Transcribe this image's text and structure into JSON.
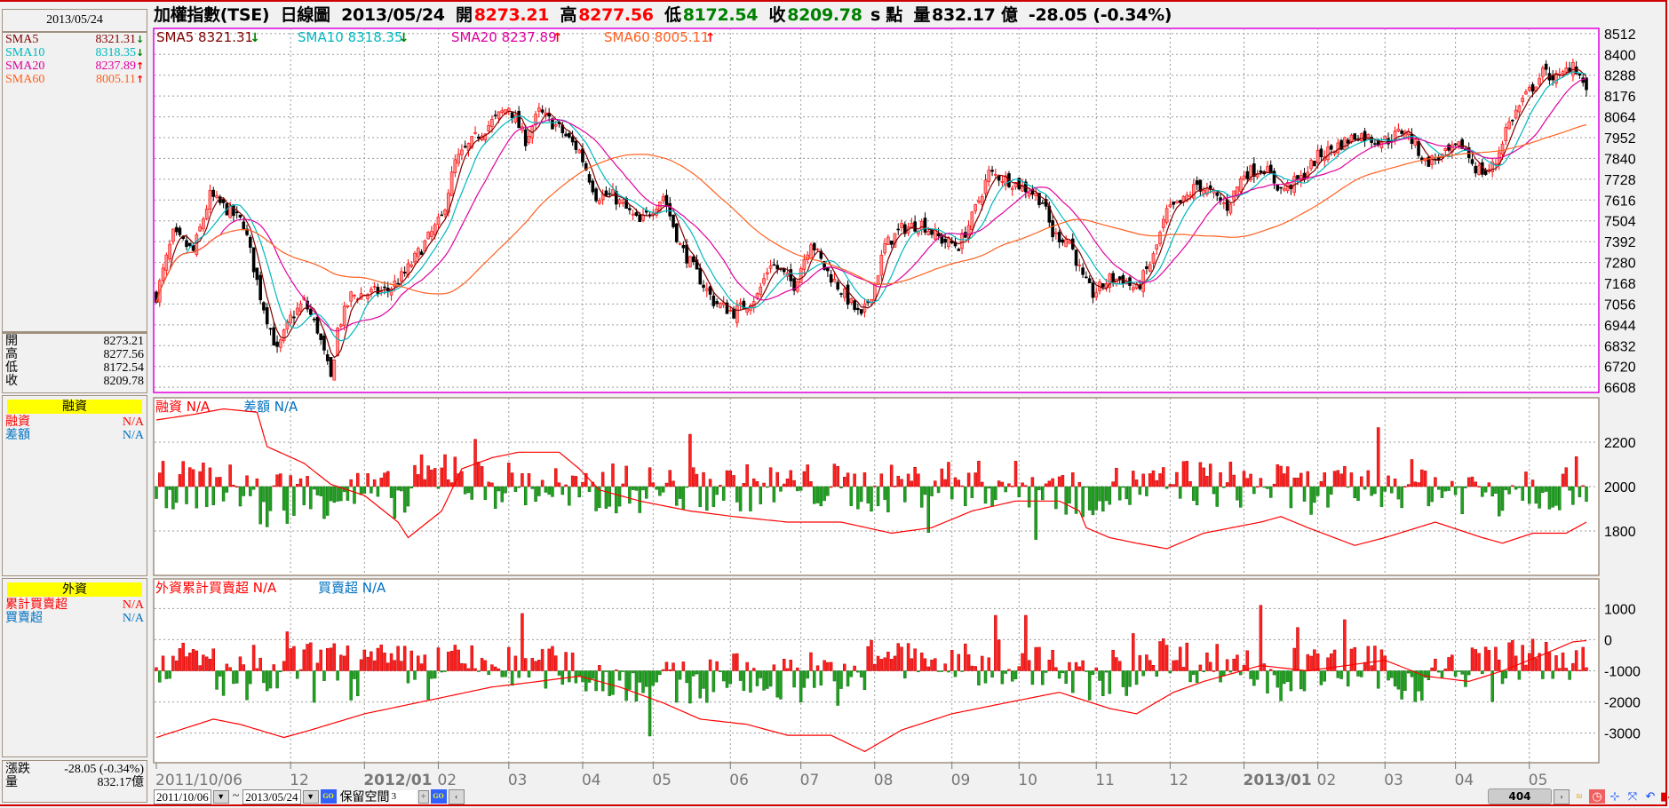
{
  "header": {
    "title": "加權指數(TSE)",
    "chart_kind": "日線圖",
    "date": "2013/05/24",
    "open_label": "開",
    "open": "8273.21",
    "high_label": "高",
    "high": "8277.56",
    "low_label": "低",
    "low": "8172.54",
    "close_label": "收",
    "close": "8209.78",
    "unit": "s 點",
    "volume_label": "量",
    "volume": "832.17 億",
    "change": "-28.05 (-0.34%)"
  },
  "left_panel": {
    "date": "2013/05/24",
    "sma": [
      {
        "label": "SMA5",
        "value": "8321.31",
        "trend": "down",
        "color": "#800000"
      },
      {
        "label": "SMA10",
        "value": "8318.35",
        "trend": "down",
        "color": "#00b8c0"
      },
      {
        "label": "SMA20",
        "value": "8237.89",
        "trend": "up",
        "color": "#e000a0"
      },
      {
        "label": "SMA60",
        "value": "8005.11",
        "trend": "up",
        "color": "#ff6020"
      }
    ],
    "ohlc": [
      {
        "label": "開",
        "value": "8273.21"
      },
      {
        "label": "高",
        "value": "8277.56"
      },
      {
        "label": "低",
        "value": "8172.54"
      },
      {
        "label": "收",
        "value": "8209.78"
      }
    ],
    "margin": {
      "title": "融資",
      "rows": [
        {
          "label": "融資",
          "value": "N/A",
          "color": "#ff0000"
        },
        {
          "label": "差額",
          "value": "N/A",
          "color": "#0070c0"
        }
      ]
    },
    "foreign": {
      "title": "外資",
      "rows": [
        {
          "label": "累計買賣超",
          "value": "N/A",
          "color": "#ff0000"
        },
        {
          "label": "買賣超",
          "value": "N/A",
          "color": "#0070c0"
        }
      ]
    },
    "change_label": "漲跌",
    "change": "-28.05 (-0.34%)",
    "volume_label": "量",
    "volume": "832.17億"
  },
  "price_legend": [
    {
      "text": "SMA5 8321.31",
      "trend": "down",
      "color": "#800000"
    },
    {
      "text": "SMA10 8318.35",
      "trend": "down",
      "color": "#00b8c0"
    },
    {
      "text": "SMA20 8237.89",
      "trend": "up",
      "color": "#e000a0"
    },
    {
      "text": "SMA60 8005.11",
      "trend": "up",
      "color": "#ff6020"
    }
  ],
  "margin_legend": [
    {
      "text": "融資 N/A",
      "color": "#ff0000"
    },
    {
      "text": "差額 N/A",
      "color": "#0070c0"
    }
  ],
  "foreign_legend": [
    {
      "text": "外資累計買賣超 N/A",
      "color": "#ff0000"
    },
    {
      "text": "買賣超 N/A",
      "color": "#0070c0"
    }
  ],
  "toolbar": {
    "start_date": "2011/10/06",
    "tilde": "~",
    "end_date": "2013/05/24",
    "reserve_label": "保留空間",
    "reserve_value": "3",
    "bar_count": "404"
  },
  "colors": {
    "up": "#ff0000",
    "down": "#000000",
    "bar_up": "#ff2020",
    "bar_down": "#20a020",
    "price_border": "#e000e0",
    "panel_border": "#a09080"
  },
  "chart_data": [
    {
      "type": "candlestick",
      "name": "加權指數(TSE) 日線圖",
      "y_ticks": [
        8512,
        8400,
        8288,
        8176,
        8064,
        7952,
        7840,
        7728,
        7616,
        7504,
        7392,
        7280,
        7168,
        7056,
        6944,
        6832,
        6720,
        6608
      ],
      "ylim": [
        6580,
        8540
      ],
      "x_range": [
        "2011-10-06",
        "2013-05-24"
      ],
      "x_tick_labels": [
        {
          "date": "2011-10-06",
          "label": "2011/10/06"
        },
        {
          "date": "2011-12-01",
          "label": "12"
        },
        {
          "date": "2012-01-02",
          "label": "2012/01",
          "bold": true
        },
        {
          "date": "2012-02-01",
          "label": "02"
        },
        {
          "date": "2012-03-01",
          "label": "03"
        },
        {
          "date": "2012-04-02",
          "label": "04"
        },
        {
          "date": "2012-05-01",
          "label": "05"
        },
        {
          "date": "2012-06-01",
          "label": "06"
        },
        {
          "date": "2012-07-02",
          "label": "07"
        },
        {
          "date": "2012-08-01",
          "label": "08"
        },
        {
          "date": "2012-09-03",
          "label": "09"
        },
        {
          "date": "2012-10-01",
          "label": "10"
        },
        {
          "date": "2012-11-01",
          "label": "11"
        },
        {
          "date": "2012-12-03",
          "label": "12"
        },
        {
          "date": "2013-01-02",
          "label": "2013/01",
          "bold": true
        },
        {
          "date": "2013-02-01",
          "label": "02"
        },
        {
          "date": "2013-03-01",
          "label": "03"
        },
        {
          "date": "2013-04-01",
          "label": "04"
        },
        {
          "date": "2013-05-01",
          "label": "05"
        }
      ],
      "approx_close": [
        [
          "2011-10-06",
          7100
        ],
        [
          "2011-10-13",
          7430
        ],
        [
          "2011-10-21",
          7340
        ],
        [
          "2011-10-28",
          7640
        ],
        [
          "2011-11-03",
          7580
        ],
        [
          "2011-11-11",
          7490
        ],
        [
          "2011-11-18",
          7100
        ],
        [
          "2011-11-25",
          6800
        ],
        [
          "2011-12-01",
          6980
        ],
        [
          "2011-12-07",
          7070
        ],
        [
          "2011-12-13",
          6920
        ],
        [
          "2011-12-19",
          6650
        ],
        [
          "2011-12-21",
          6920
        ],
        [
          "2011-12-27",
          7100
        ],
        [
          "2012-01-11",
          7130
        ],
        [
          "2012-01-18",
          7220
        ],
        [
          "2012-02-02",
          7520
        ],
        [
          "2012-02-08",
          7820
        ],
        [
          "2012-02-17",
          7970
        ],
        [
          "2012-03-01",
          8120
        ],
        [
          "2012-03-08",
          7940
        ],
        [
          "2012-03-14",
          8090
        ],
        [
          "2012-03-22",
          8000
        ],
        [
          "2012-03-30",
          7880
        ],
        [
          "2012-04-06",
          7640
        ],
        [
          "2012-04-13",
          7640
        ],
        [
          "2012-04-25",
          7490
        ],
        [
          "2012-05-04",
          7640
        ],
        [
          "2012-05-11",
          7370
        ],
        [
          "2012-05-18",
          7220
        ],
        [
          "2012-05-25",
          7070
        ],
        [
          "2012-06-04",
          7010
        ],
        [
          "2012-06-13",
          7100
        ],
        [
          "2012-06-19",
          7280
        ],
        [
          "2012-06-28",
          7160
        ],
        [
          "2012-07-05",
          7400
        ],
        [
          "2012-07-11",
          7250
        ],
        [
          "2012-07-18",
          7130
        ],
        [
          "2012-07-26",
          6980
        ],
        [
          "2012-08-01",
          7160
        ],
        [
          "2012-08-06",
          7370
        ],
        [
          "2012-08-13",
          7460
        ],
        [
          "2012-08-21",
          7490
        ],
        [
          "2012-08-29",
          7400
        ],
        [
          "2012-09-05",
          7370
        ],
        [
          "2012-09-11",
          7520
        ],
        [
          "2012-09-18",
          7760
        ],
        [
          "2012-09-25",
          7730
        ],
        [
          "2012-10-04",
          7670
        ],
        [
          "2012-10-10",
          7610
        ],
        [
          "2012-10-15",
          7430
        ],
        [
          "2012-10-22",
          7400
        ],
        [
          "2012-10-26",
          7190
        ],
        [
          "2012-10-31",
          7110
        ],
        [
          "2012-11-07",
          7190
        ],
        [
          "2012-11-13",
          7190
        ],
        [
          "2012-11-19",
          7130
        ],
        [
          "2012-11-26",
          7310
        ],
        [
          "2012-11-30",
          7550
        ],
        [
          "2012-12-07",
          7610
        ],
        [
          "2012-12-13",
          7700
        ],
        [
          "2012-12-20",
          7640
        ],
        [
          "2012-12-26",
          7580
        ],
        [
          "2013-01-02",
          7760
        ],
        [
          "2013-01-10",
          7790
        ],
        [
          "2013-01-17",
          7670
        ],
        [
          "2013-01-25",
          7730
        ],
        [
          "2013-02-01",
          7850
        ],
        [
          "2013-02-19",
          7970
        ],
        [
          "2013-02-26",
          7940
        ],
        [
          "2013-03-04",
          7940
        ],
        [
          "2013-03-11",
          8000
        ],
        [
          "2013-03-19",
          7820
        ],
        [
          "2013-03-26",
          7850
        ],
        [
          "2013-04-03",
          7910
        ],
        [
          "2013-04-09",
          7790
        ],
        [
          "2013-04-12",
          7760
        ],
        [
          "2013-04-17",
          7820
        ],
        [
          "2013-04-22",
          8000
        ],
        [
          "2013-04-29",
          8150
        ],
        [
          "2013-05-07",
          8300
        ],
        [
          "2013-05-14",
          8270
        ],
        [
          "2013-05-20",
          8360
        ],
        [
          "2013-05-24",
          8209.78
        ]
      ],
      "last_candle": {
        "date": "2013-05-24",
        "open": 8273.21,
        "high": 8277.56,
        "low": 8172.54,
        "close": 8209.78
      },
      "overlays": [
        "SMA5",
        "SMA10",
        "SMA20",
        "SMA60"
      ]
    },
    {
      "type": "bar+line",
      "name": "融資",
      "y_ticks": [
        2200,
        2000,
        1800
      ],
      "ylim": [
        1600,
        2400
      ],
      "bar_baseline": 2000,
      "line_series": "融資",
      "bar_series": "差額",
      "approx_line": [
        [
          "2011-10-06",
          2300
        ],
        [
          "2011-10-21",
          2325
        ],
        [
          "2011-11-03",
          2350
        ],
        [
          "2011-11-17",
          2335
        ],
        [
          "2011-11-22",
          2180
        ],
        [
          "2011-12-07",
          2105
        ],
        [
          "2011-12-19",
          2010
        ],
        [
          "2012-01-02",
          1960
        ],
        [
          "2012-01-16",
          1840
        ],
        [
          "2012-01-19",
          1770
        ],
        [
          "2012-02-02",
          1890
        ],
        [
          "2012-02-10",
          2080
        ],
        [
          "2012-02-23",
          2130
        ],
        [
          "2012-03-06",
          2155
        ],
        [
          "2012-03-22",
          2155
        ],
        [
          "2012-03-30",
          2080
        ],
        [
          "2012-04-09",
          1985
        ],
        [
          "2012-04-25",
          1935
        ],
        [
          "2012-05-16",
          1890
        ],
        [
          "2012-06-04",
          1865
        ],
        [
          "2012-06-26",
          1840
        ],
        [
          "2012-07-18",
          1840
        ],
        [
          "2012-08-08",
          1790
        ],
        [
          "2012-08-24",
          1815
        ],
        [
          "2012-09-11",
          1890
        ],
        [
          "2012-09-28",
          1935
        ],
        [
          "2012-10-17",
          1935
        ],
        [
          "2012-10-25",
          1890
        ],
        [
          "2012-10-29",
          1815
        ],
        [
          "2012-11-07",
          1770
        ],
        [
          "2012-11-19",
          1745
        ],
        [
          "2012-11-30",
          1720
        ],
        [
          "2012-12-17",
          1790
        ],
        [
          "2013-01-09",
          1840
        ],
        [
          "2013-01-17",
          1865
        ],
        [
          "2013-01-29",
          1815
        ],
        [
          "2013-02-18",
          1735
        ],
        [
          "2013-03-01",
          1770
        ],
        [
          "2013-03-22",
          1840
        ],
        [
          "2013-04-11",
          1770
        ],
        [
          "2013-04-19",
          1745
        ],
        [
          "2013-05-02",
          1790
        ],
        [
          "2013-05-16",
          1790
        ],
        [
          "2013-05-24",
          1840
        ]
      ]
    },
    {
      "type": "bar+line",
      "name": "外資",
      "y_ticks": [
        1000,
        0,
        -1000,
        -2000,
        -3000
      ],
      "ylim": [
        -3950,
        1950
      ],
      "bar_baseline": -1000,
      "line_series": "外資累計買賣超",
      "bar_series": "買賣超",
      "approx_line": [
        [
          "2011-10-06",
          -3140
        ],
        [
          "2011-10-31",
          -2550
        ],
        [
          "2011-11-10",
          -2720
        ],
        [
          "2011-11-29",
          -3140
        ],
        [
          "2011-12-09",
          -2900
        ],
        [
          "2012-01-02",
          -2380
        ],
        [
          "2012-02-02",
          -1860
        ],
        [
          "2012-02-23",
          -1520
        ],
        [
          "2012-03-14",
          -1340
        ],
        [
          "2012-03-30",
          -1170
        ],
        [
          "2012-04-17",
          -1520
        ],
        [
          "2012-05-04",
          -2030
        ],
        [
          "2012-05-21",
          -2550
        ],
        [
          "2012-06-08",
          -2720
        ],
        [
          "2012-06-26",
          -3070
        ],
        [
          "2012-07-13",
          -3070
        ],
        [
          "2012-07-27",
          -3590
        ],
        [
          "2012-08-13",
          -2900
        ],
        [
          "2012-09-03",
          -2380
        ],
        [
          "2012-09-25",
          -2030
        ],
        [
          "2012-10-17",
          -1690
        ],
        [
          "2012-11-07",
          -2210
        ],
        [
          "2012-11-19",
          -2380
        ],
        [
          "2012-12-04",
          -1690
        ],
        [
          "2012-12-17",
          -1340
        ],
        [
          "2013-01-09",
          -830
        ],
        [
          "2013-01-29",
          -1000
        ],
        [
          "2013-03-01",
          -660
        ],
        [
          "2013-03-19",
          -1170
        ],
        [
          "2013-04-05",
          -1340
        ],
        [
          "2013-04-19",
          -1000
        ],
        [
          "2013-05-07",
          -480
        ],
        [
          "2013-05-20",
          -70
        ],
        [
          "2013-05-24",
          -30
        ]
      ]
    }
  ]
}
